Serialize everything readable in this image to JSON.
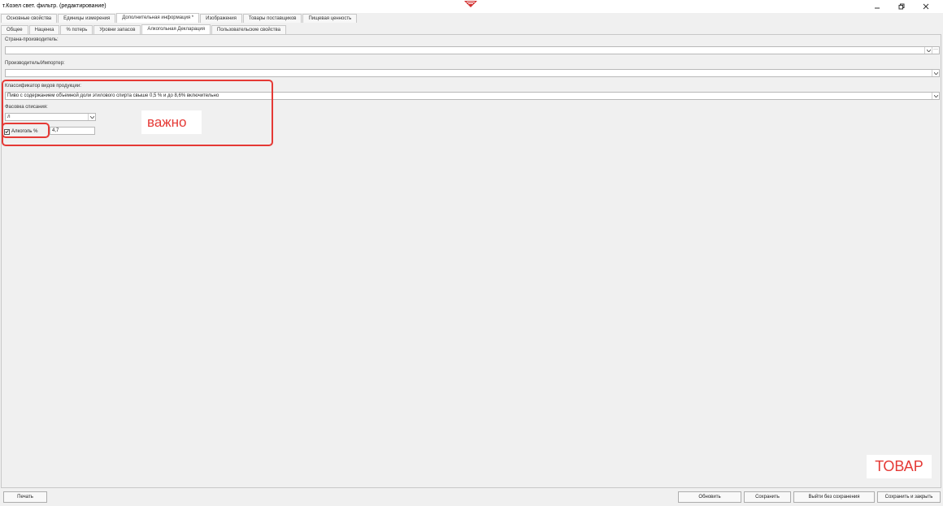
{
  "window": {
    "title": "т.Козел свет. фильтр. (редактирование)"
  },
  "tabs": [
    {
      "label": "Основные свойства"
    },
    {
      "label": "Единицы измерения"
    },
    {
      "label": "Дополнительная информация *"
    },
    {
      "label": "Изображения"
    },
    {
      "label": "Товары поставщиков"
    },
    {
      "label": "Пищевая ценность"
    }
  ],
  "subtabs": [
    {
      "label": "Общее"
    },
    {
      "label": "Наценка"
    },
    {
      "label": "% потерь"
    },
    {
      "label": "Уровни запасов"
    },
    {
      "label": "Алкогольная Декларация"
    },
    {
      "label": "Пользовательские свойства"
    }
  ],
  "form": {
    "country_label": "Страна-производитель:",
    "country_value": "",
    "producer_label": "Производитель/Импортер:",
    "producer_value": "",
    "classifier_label": "Классификатор видов продукции:",
    "classifier_value": "Пиво с  содержанием объемной  доли этилового спирта  свыше 0,5 % и до 8,6%  включительно",
    "packaging_label": "Фасовка списания:",
    "packaging_value": "л",
    "alcohol_label": "Алкоголь %",
    "alcohol_checked": true,
    "alcohol_value": "4,7"
  },
  "annotations": {
    "important": "важно",
    "product": "ТОВАР",
    "color": "#e53935"
  },
  "buttons": {
    "print": "Печать",
    "refresh": "Обновить",
    "save": "Сохранить",
    "exit_no_save": "Выйти без сохранения",
    "save_close": "Сохранить и закрыть"
  }
}
